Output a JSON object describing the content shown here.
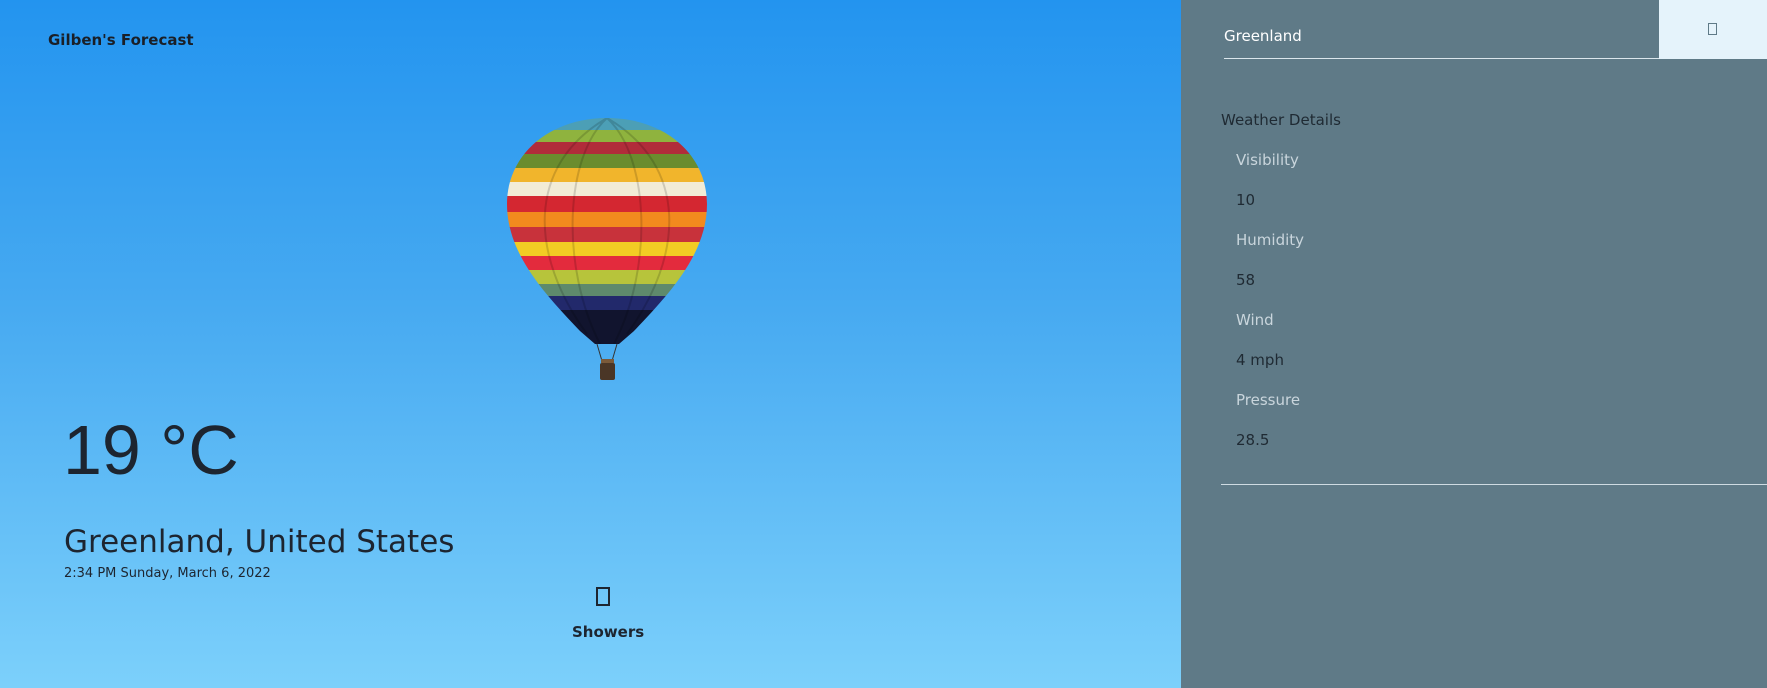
{
  "app": {
    "brand": "Gilben's Forecast"
  },
  "current": {
    "temperature": "19 °C",
    "location": "Greenland, United States",
    "datetime": "2:34 PM Sunday, March 6, 2022",
    "condition": "Showers",
    "condition_icon": "weather-glyph-icon"
  },
  "search": {
    "value": "Greenland",
    "button_icon": "search-icon"
  },
  "details": {
    "title": "Weather Details",
    "items": [
      {
        "label": "Visibility",
        "value": "10"
      },
      {
        "label": "Humidity",
        "value": "58"
      },
      {
        "label": "Wind",
        "value": "4 mph"
      },
      {
        "label": "Pressure",
        "value": "28.5"
      }
    ]
  },
  "colors": {
    "sidebar": "#5f7a87",
    "sky_top": "#2394ef",
    "sky_bottom": "#7cd0fb",
    "search_button": "#e5f3fb"
  }
}
